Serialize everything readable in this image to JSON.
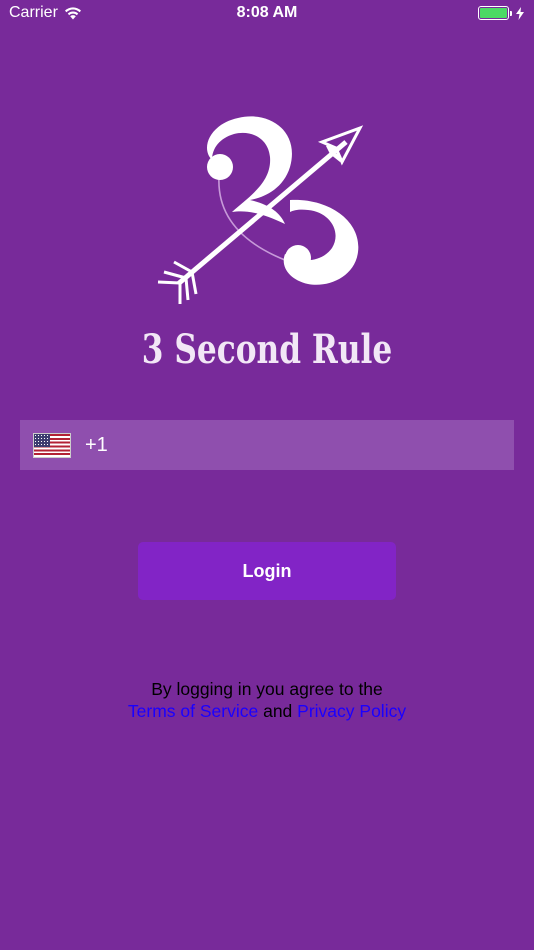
{
  "status_bar": {
    "carrier": "Carrier",
    "time": "8:08 AM",
    "battery_level": 1.0,
    "battery_color": "#4cd964"
  },
  "brand": {
    "name": "3 Second Rule",
    "logo_icon": "cupid-arrow-three-logo"
  },
  "phone": {
    "country_flag": "us-flag-icon",
    "dial_code": "+1",
    "value": "",
    "placeholder": ""
  },
  "login_label": "Login",
  "terms": {
    "line1": "By logging in you agree to the",
    "tos_link": "Terms of Service",
    "and": "and",
    "privacy_link": "Privacy Policy",
    "link_color": "#1a00ff"
  },
  "colors": {
    "background": "#782a9a",
    "field": "#8f4fae",
    "button": "#8224c6"
  }
}
